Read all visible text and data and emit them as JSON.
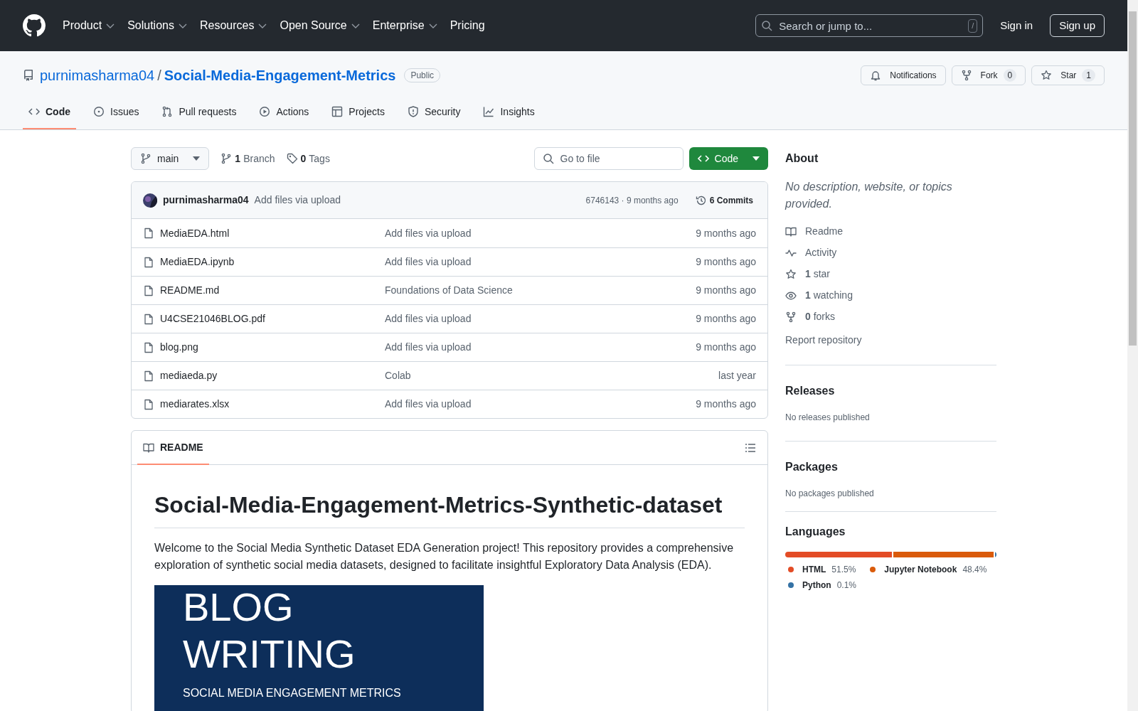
{
  "header": {
    "nav": [
      {
        "label": "Product",
        "dropdown": true
      },
      {
        "label": "Solutions",
        "dropdown": true
      },
      {
        "label": "Resources",
        "dropdown": true
      },
      {
        "label": "Open Source",
        "dropdown": true
      },
      {
        "label": "Enterprise",
        "dropdown": true
      },
      {
        "label": "Pricing",
        "dropdown": false
      }
    ],
    "search": {
      "placeholder": "Search or jump to...",
      "shortcut": "/"
    },
    "sign_in": "Sign in",
    "sign_up": "Sign up"
  },
  "repo": {
    "owner": "purnimasharma04",
    "separator": "/",
    "name": "Social-Media-Engagement-Metrics",
    "visibility": "Public",
    "actions": [
      {
        "label": "Notifications",
        "kind": "bell"
      },
      {
        "label": "Fork",
        "kind": "fork",
        "count": "0"
      },
      {
        "label": "Star",
        "kind": "star",
        "count": "1"
      }
    ],
    "tabs": [
      {
        "label": "Code",
        "kind": "code",
        "selected": true
      },
      {
        "label": "Issues",
        "kind": "issue",
        "selected": false
      },
      {
        "label": "Pull requests",
        "kind": "pr",
        "selected": false
      },
      {
        "label": "Actions",
        "kind": "play",
        "selected": false
      },
      {
        "label": "Projects",
        "kind": "table",
        "selected": false
      },
      {
        "label": "Security",
        "kind": "shield",
        "selected": false
      },
      {
        "label": "Insights",
        "kind": "graph",
        "selected": false
      }
    ]
  },
  "toolbar": {
    "branch": "main",
    "branches_count": "1",
    "branches_label": "Branch",
    "tags_count": "0",
    "tags_label": "Tags",
    "go_to_file": {
      "placeholder": "Go to file"
    },
    "code_button": "Code"
  },
  "commit": {
    "author": "purnimasharma04",
    "message": "Add files via upload",
    "hash": "6746143 · 9 months ago",
    "commits": "6 Commits"
  },
  "files": [
    {
      "name": "MediaEDA.html",
      "message": "Add files via upload",
      "time": "9 months ago"
    },
    {
      "name": "MediaEDA.ipynb",
      "message": "Add files via upload",
      "time": "9 months ago"
    },
    {
      "name": "README.md",
      "message": "Foundations of Data Science",
      "time": "9 months ago"
    },
    {
      "name": "U4CSE21046BLOG.pdf",
      "message": "Add files via upload",
      "time": "9 months ago"
    },
    {
      "name": "blog.png",
      "message": "Add files via upload",
      "time": "9 months ago"
    },
    {
      "name": "mediaeda.py",
      "message": "Colab",
      "time": "last year"
    },
    {
      "name": "mediarates.xlsx",
      "message": "Add files via upload",
      "time": "9 months ago"
    }
  ],
  "readme": {
    "tab": "README",
    "title": "Social-Media-Engagement-Metrics-Synthetic-dataset",
    "paragraph": "Welcome to the Social Media Synthetic Dataset EDA Generation project! This repository provides a comprehensive exploration of synthetic social media datasets, designed to facilitate insightful Exploratory Data Analysis (EDA).",
    "banner": [
      "BLOG",
      "WRITING",
      "SOCIAL MEDIA ENGAGEMENT METRICS"
    ]
  },
  "sidebar": {
    "about_title": "About",
    "description": "No description, website, or topics provided.",
    "links": [
      {
        "kind": "book",
        "label": "Readme"
      },
      {
        "kind": "pulse",
        "label": "Activity"
      },
      {
        "kind": "star",
        "count": "1",
        "label": "star"
      },
      {
        "kind": "eye",
        "count": "1",
        "label": "watching"
      },
      {
        "kind": "fork",
        "count": "0",
        "label": "forks"
      }
    ],
    "report": "Report repository",
    "sections": [
      {
        "title": "Releases",
        "note": "No releases published"
      },
      {
        "title": "Packages",
        "note": "No packages published"
      }
    ],
    "languages_title": "Languages",
    "languages": [
      {
        "name": "HTML",
        "percent": "51.5%",
        "level": 0.515,
        "color": "#e34c26"
      },
      {
        "name": "Jupyter Notebook",
        "percent": "48.4%",
        "level": 0.484,
        "color": "#da5b0b"
      },
      {
        "name": "Python",
        "percent": "0.1%",
        "level": 0.001,
        "color": "#3572a5"
      }
    ]
  }
}
